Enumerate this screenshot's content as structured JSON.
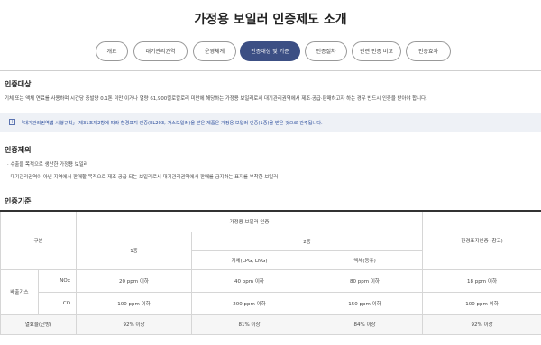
{
  "title": "가정용 보일러 인증제도 소개",
  "tabs": [
    {
      "label": "개요",
      "active": false
    },
    {
      "label": "대기관리권역",
      "active": false
    },
    {
      "label": "운영체계",
      "active": false
    },
    {
      "label": "인증대상 및 기준",
      "active": true
    },
    {
      "label": "인증절차",
      "active": false
    },
    {
      "label": "관련 인증 비교",
      "active": false
    },
    {
      "label": "인증효과",
      "active": false
    }
  ],
  "sections": {
    "target_title": "인증대상",
    "target_text": "기체 또는 액체 연료를 사용하며 시간당 증발량 0.1톤 미만 이거나 열량 61,900킬로칼로리 미만에 해당하는 가정용 보일러로서 대기관리권역에서 제조·공급·판매하고자 하는 경우 반드시 인증을 받아야 합니다.",
    "note": "「대기관리권역법 시행규칙」 제31조제2항에 따라 환경표지 인증(EL203, 가스보일러)을 받은 제품은 가정용 보일러 인증(1종)을 받은 것으로 간주됩니다.",
    "exclusion_title": "인증제외",
    "exclusions": [
      "수출을 목적으로 생산한 가정용 보일러",
      "대기관리권역이 아닌 지역에서 판매할 목적으로 제조·공급 되는 보일러로서 대기관리권역에서 판매를 금지하는 표지를 부착한 보일러"
    ],
    "criteria_title": "인증기준"
  },
  "table": {
    "col_category": "구분",
    "group_header": "가정용 보일러 인증",
    "type1": "1종",
    "type2": "2종",
    "type2_gas": "기체(LPG, LNG)",
    "type2_liquid": "액체(등유)",
    "eco_label": "환경표지인증 (참고)",
    "emission_label": "배출가스",
    "rows": [
      {
        "label": "NOx",
        "type1": "20 ppm 이하",
        "gas": "40 ppm 이하",
        "liquid": "80 ppm 이하",
        "eco": "18 ppm 이하"
      },
      {
        "label": "CO",
        "type1": "100 ppm 이하",
        "gas": "200 ppm 이하",
        "liquid": "150 ppm 이하",
        "eco": "100 ppm 이하"
      }
    ],
    "efficiency": {
      "label": "열효율(난방)",
      "type1": "92% 이상",
      "gas": "81% 이상",
      "liquid": "84% 이상",
      "eco": "92% 이상"
    }
  }
}
